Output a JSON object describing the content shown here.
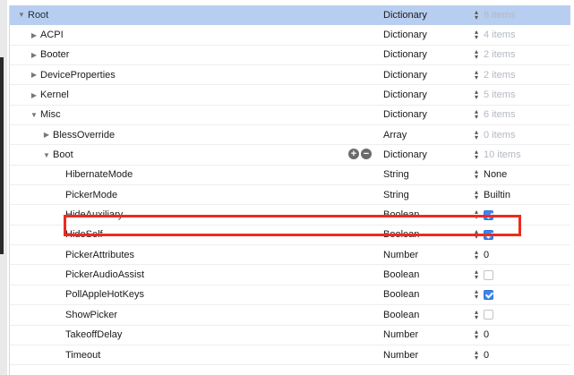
{
  "rows": [
    {
      "key": "Root",
      "type": "Dictionary",
      "value": "8 items",
      "value_kind": "count",
      "level": 0,
      "disclosure": "expanded",
      "selected": true
    },
    {
      "key": "ACPI",
      "type": "Dictionary",
      "value": "4 items",
      "value_kind": "count",
      "level": 1,
      "disclosure": "collapsed"
    },
    {
      "key": "Booter",
      "type": "Dictionary",
      "value": "2 items",
      "value_kind": "count",
      "level": 1,
      "disclosure": "collapsed"
    },
    {
      "key": "DeviceProperties",
      "type": "Dictionary",
      "value": "2 items",
      "value_kind": "count",
      "level": 1,
      "disclosure": "collapsed"
    },
    {
      "key": "Kernel",
      "type": "Dictionary",
      "value": "5 items",
      "value_kind": "count",
      "level": 1,
      "disclosure": "collapsed"
    },
    {
      "key": "Misc",
      "type": "Dictionary",
      "value": "6 items",
      "value_kind": "count",
      "level": 1,
      "disclosure": "expanded"
    },
    {
      "key": "BlessOverride",
      "type": "Array",
      "value": "0 items",
      "value_kind": "count",
      "level": 2,
      "disclosure": "collapsed"
    },
    {
      "key": "Boot",
      "type": "Dictionary",
      "value": "10 items",
      "value_kind": "count",
      "level": 2,
      "disclosure": "expanded",
      "add_remove": true
    },
    {
      "key": "HibernateMode",
      "type": "String",
      "value": "None",
      "value_kind": "text",
      "level": 3
    },
    {
      "key": "PickerMode",
      "type": "String",
      "value": "Builtin",
      "value_kind": "text",
      "level": 3
    },
    {
      "key": "HideAuxiliary",
      "type": "Boolean",
      "value": true,
      "value_kind": "bool",
      "level": 3,
      "highlighted": true
    },
    {
      "key": "HideSelf",
      "type": "Boolean",
      "value": true,
      "value_kind": "bool",
      "level": 3
    },
    {
      "key": "PickerAttributes",
      "type": "Number",
      "value": "0",
      "value_kind": "text",
      "level": 3
    },
    {
      "key": "PickerAudioAssist",
      "type": "Boolean",
      "value": false,
      "value_kind": "bool",
      "level": 3
    },
    {
      "key": "PollAppleHotKeys",
      "type": "Boolean",
      "value": true,
      "value_kind": "bool",
      "level": 3
    },
    {
      "key": "ShowPicker",
      "type": "Boolean",
      "value": false,
      "value_kind": "bool",
      "level": 3
    },
    {
      "key": "TakeoffDelay",
      "type": "Number",
      "value": "0",
      "value_kind": "text",
      "level": 3
    },
    {
      "key": "Timeout",
      "type": "Number",
      "value": "0",
      "value_kind": "text",
      "level": 3
    }
  ],
  "colors": {
    "selection": "#b8cef0",
    "highlight_frame": "#ee2a20",
    "checkbox_checked": "#3a86f2",
    "muted_text": "#b3b8c0"
  },
  "icons": {
    "add": "add-circle-icon",
    "remove": "remove-circle-icon",
    "stepper": "stepper-icon",
    "disclosure_expanded": "disclosure-expanded-icon",
    "disclosure_collapsed": "disclosure-collapsed-icon"
  }
}
